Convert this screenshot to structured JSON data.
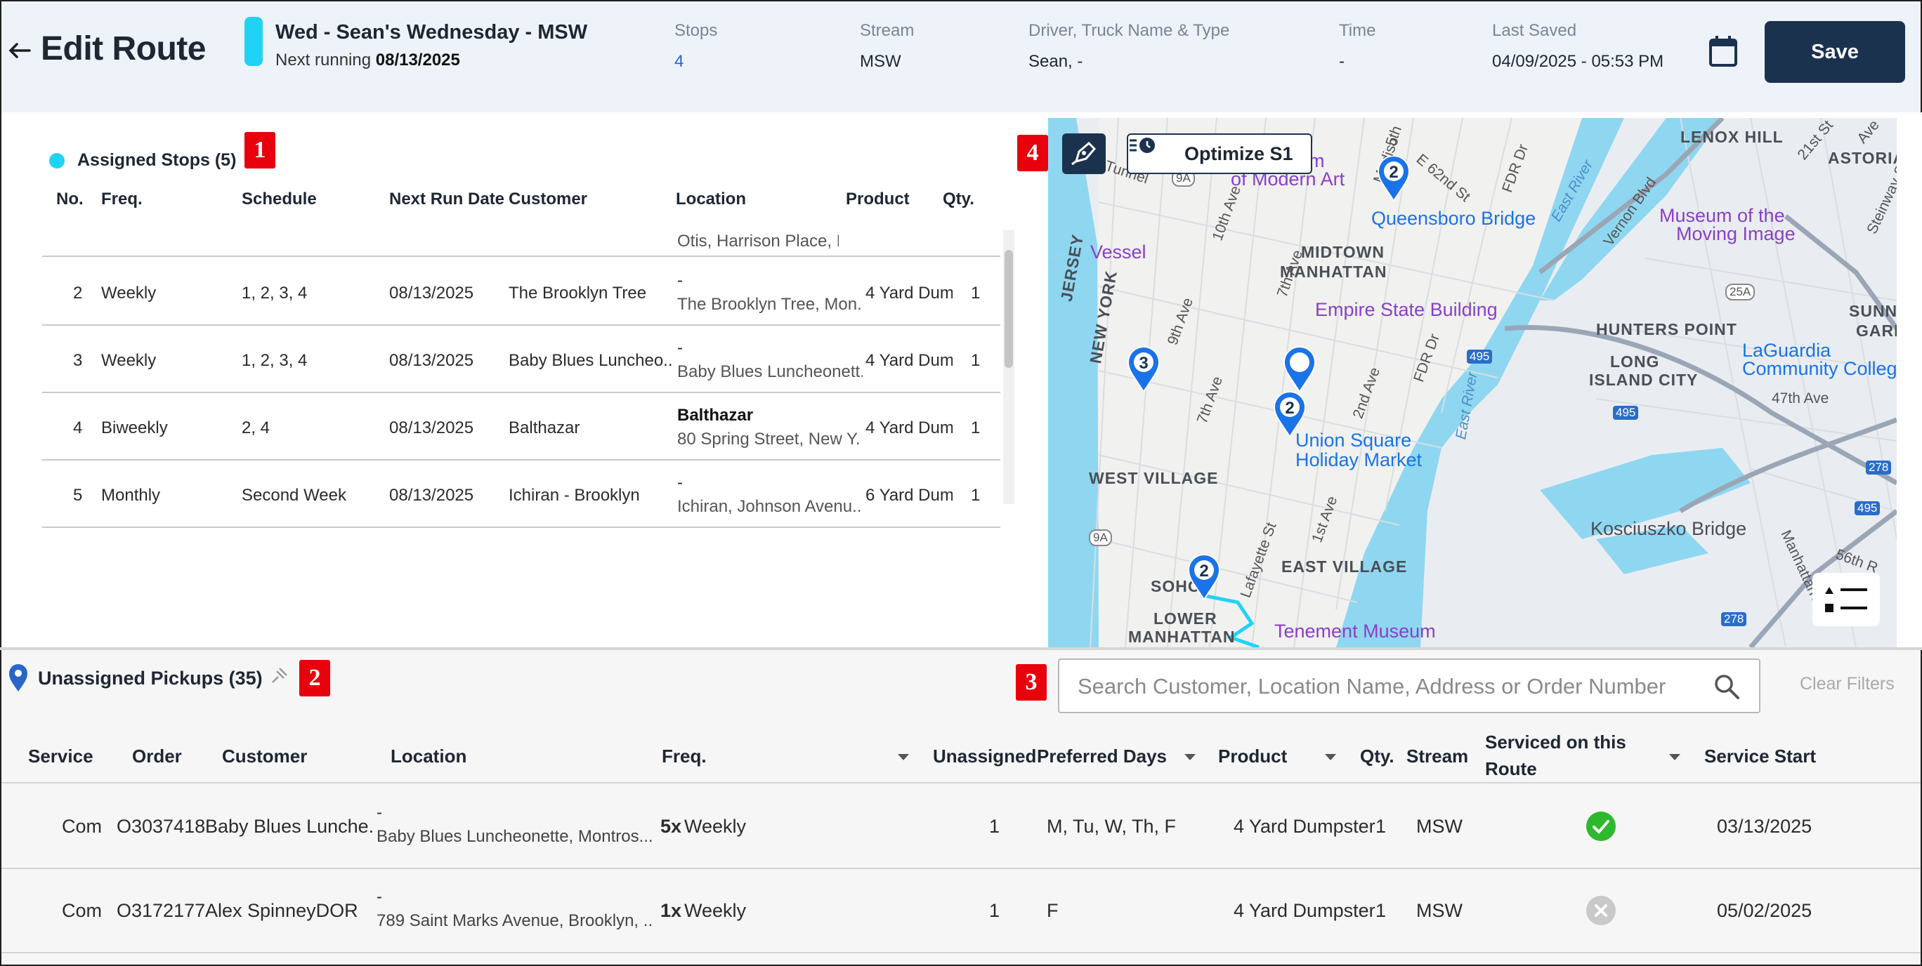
{
  "header": {
    "title": "Edit Route",
    "route_name": "Wed - Sean's Wednesday - MSW",
    "next_running_label": "Next running",
    "next_running_date": "08/13/2025",
    "route_color": "#20d3f5",
    "stops_label": "Stops",
    "stops_value": "4",
    "stream_label": "Stream",
    "stream_value": "MSW",
    "driver_label": "Driver, Truck Name & Type",
    "driver_value": "Sean, -",
    "time_label": "Time",
    "time_value": "-",
    "last_saved_label": "Last Saved",
    "last_saved_value": "04/09/2025 - 05:53 PM",
    "save_label": "Save",
    "icons": [
      "back-arrow-icon",
      "calendar-icon"
    ]
  },
  "badges": {
    "b1": "1",
    "b2": "2",
    "b3": "3",
    "b4": "4"
  },
  "assigned": {
    "title": "Assigned Stops (5)",
    "columns": [
      "No.",
      "Freq.",
      "Schedule",
      "Next Run Date",
      "Customer",
      "Location",
      "Product",
      "Qty."
    ],
    "partial_row_location": "Otis, Harrison Place, Bro...",
    "rows": [
      {
        "no": "2",
        "freq": "Weekly",
        "schedule": "1, 2, 3, 4",
        "next_run": "08/13/2025",
        "customer": "The Brooklyn Tree",
        "loc_name": "-",
        "loc_addr": "The Brooklyn Tree, Mon...",
        "product": "4 Yard Dum...",
        "qty": "1"
      },
      {
        "no": "3",
        "freq": "Weekly",
        "schedule": "1, 2, 3, 4",
        "next_run": "08/13/2025",
        "customer": "Baby Blues Luncheo...",
        "loc_name": "-",
        "loc_addr": "Baby Blues Luncheonett...",
        "product": "4 Yard Dum...",
        "qty": "1"
      },
      {
        "no": "4",
        "freq": "Biweekly",
        "schedule": "2, 4",
        "next_run": "08/13/2025",
        "customer": "Balthazar",
        "loc_name": "Balthazar",
        "loc_addr": "80 Spring Street, New Y...",
        "product": "4 Yard Dum...",
        "qty": "1"
      },
      {
        "no": "5",
        "freq": "Monthly",
        "schedule": "Second Week",
        "next_run": "08/13/2025",
        "customer": "Ichiran - Brooklyn",
        "loc_name": "-",
        "loc_addr": "Ichiran, Johnson Avenu...",
        "product": "6 Yard Dum...",
        "qty": "1"
      }
    ]
  },
  "map": {
    "optimize_label": "Optimize S1",
    "areas": [
      "LENOX HILL",
      "ASTORIA",
      "MIDTOWN",
      "MANHATTAN",
      "HUNTERS POINT",
      "SUNNY",
      "GARDE",
      "LONG",
      "ISLAND CITY",
      "WEST VILLAGE",
      "EAST VILLAGE",
      "SOHO",
      "LOWER",
      "MANHATTAN",
      "JERSEY",
      "NEW YORK"
    ],
    "pois": [
      "Museum",
      "of Modern Art",
      "Queensboro Bridge",
      "Museum of the",
      "Moving Image",
      "Vessel",
      "Empire State Building",
      "LaGuardia",
      "Community Colleg",
      "Union Square",
      "Holiday Market",
      "Kosciuszko Bridge",
      "Tenement Museum"
    ],
    "streets": [
      "Tunnel",
      "10th Ave",
      "9th Ave",
      "7th Ave",
      "7th Ave",
      "2nd Ave",
      "1st Ave",
      "FDR Dr",
      "FDR Dr",
      "E 62nd St",
      "5th",
      "Madiso",
      "Lafayette St",
      "East River",
      "East River",
      "Vernon Blvd",
      "Steinway St",
      "47th Ave",
      "56th R",
      "21st St",
      "Manhattan Ave",
      "Ave"
    ],
    "shields": [
      "9A",
      "9A",
      "495",
      "495",
      "495",
      "278",
      "278",
      "25A"
    ],
    "pins": [
      "2",
      "3",
      "2",
      "2"
    ],
    "icons": [
      "draw-route-icon",
      "optimize-icon",
      "map-legend-icon"
    ]
  },
  "unassigned": {
    "title": "Unassigned Pickups (35)",
    "search_placeholder": "Search Customer, Location Name, Address or Order Number",
    "clear_filters_label": "Clear Filters",
    "columns": {
      "service": "Service",
      "order": "Order",
      "customer": "Customer",
      "location": "Location",
      "freq": "Freq.",
      "unassigned": "Unassigned",
      "preferred_days": "Preferred Days",
      "product": "Product",
      "qty": "Qty.",
      "stream": "Stream",
      "serviced_line1": "Serviced on this",
      "serviced_line2": "Route",
      "service_start": "Service Start"
    },
    "rows": [
      {
        "service": "Com",
        "order": "O3037418",
        "customer": "Baby Blues Lunche...",
        "loc_name": "-",
        "loc_addr": "Baby Blues Luncheonette, Montros...",
        "freq_mult": "5x",
        "freq": "Weekly",
        "unassigned": "1",
        "days": "M, Tu, W, Th, F",
        "product": "4 Yard Dumpster",
        "qty": "1",
        "stream": "MSW",
        "serviced": true,
        "start": "03/13/2025"
      },
      {
        "service": "Com",
        "order": "O3172177",
        "customer": "Alex SpinneyDOR",
        "loc_name": "-",
        "loc_addr": "789 Saint Marks Avenue, Brooklyn, ...",
        "freq_mult": "1x",
        "freq": "Weekly",
        "unassigned": "1",
        "days": "F",
        "product": "4 Yard Dumpster",
        "qty": "1",
        "stream": "MSW",
        "serviced": false,
        "start": "05/02/2025"
      }
    ],
    "icons": [
      "location-pin-icon",
      "unpin-icon",
      "search-icon",
      "check-circle-icon",
      "x-circle-icon"
    ]
  },
  "colors": {
    "brand_navy": "#1b324f",
    "route_cyan": "#20d3f5",
    "success_green": "#2eb82e",
    "disabled_gray": "#c9c9c9",
    "badge_red": "#e8000d"
  }
}
